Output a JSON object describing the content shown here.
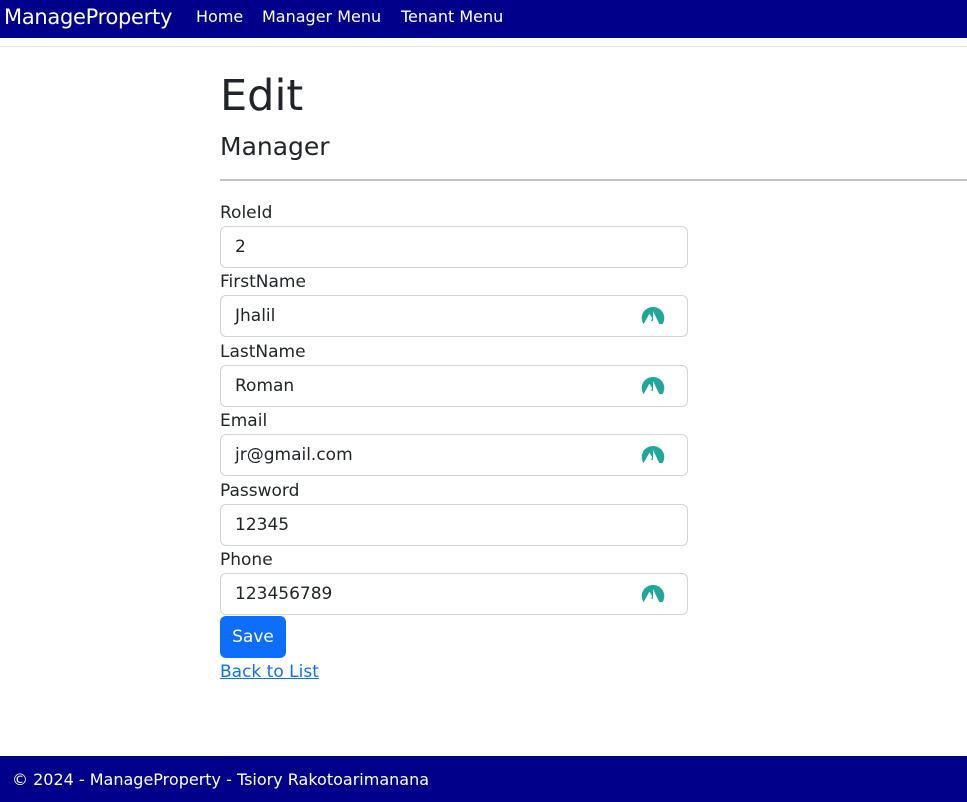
{
  "navbar": {
    "brand": "ManageProperty",
    "links": [
      "Home",
      "Manager Menu",
      "Tenant Menu"
    ]
  },
  "page": {
    "title": "Edit",
    "subtitle": "Manager"
  },
  "form": {
    "fields": [
      {
        "label": "RoleId",
        "value": "2",
        "icon": null
      },
      {
        "label": "FirstName",
        "value": "Jhalil",
        "icon": "nordpass-autofill-icon"
      },
      {
        "label": "LastName",
        "value": "Roman",
        "icon": "nordpass-autofill-icon"
      },
      {
        "label": "Email",
        "value": "jr@gmail.com",
        "icon": "nordpass-autofill-icon"
      },
      {
        "label": "Password",
        "value": "12345",
        "icon": null
      },
      {
        "label": "Phone",
        "value": "123456789",
        "icon": "nordpass-autofill-icon"
      }
    ],
    "save_label": "Save",
    "back_link": "Back to List"
  },
  "footer": {
    "text": "© 2024 - ManageProperty - Tsiory Rakotoarimanana"
  },
  "colors": {
    "navbar": "#00008b",
    "primary": "#0d6efd",
    "autofill_icon": "#1fa89a"
  }
}
